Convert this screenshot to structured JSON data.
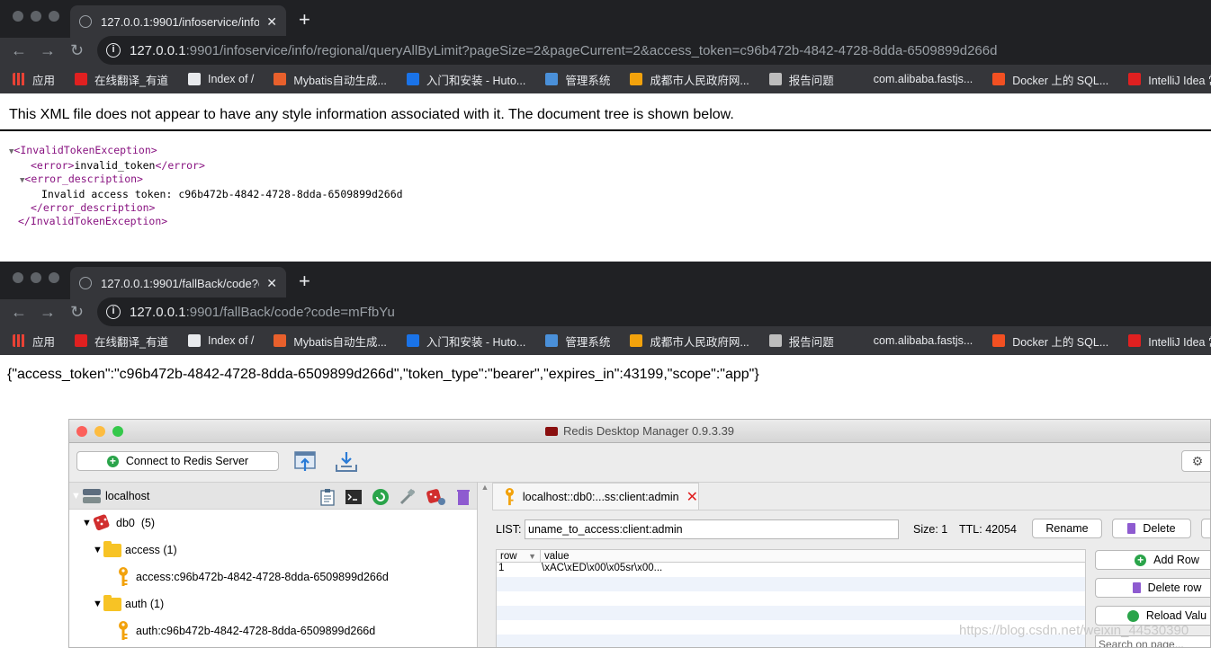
{
  "browser1": {
    "tab_title": "127.0.0.1:9901/infoservice/info",
    "url_host": "127.0.0.1",
    "url_rest": ":9901/infoservice/info/regional/queryAllByLimit?pageSize=2&pageCurrent=2&access_token=c96b472b-4842-4728-8dda-6509899d266d"
  },
  "browser2": {
    "tab_title": "127.0.0.1:9901/fallBack/code?c",
    "url_host": "127.0.0.1",
    "url_rest": ":9901/fallBack/code?code=mFfbYu"
  },
  "bookmarks": [
    {
      "label": "应用",
      "color": "#e94235"
    },
    {
      "label": "在线翻译_有道",
      "color": "#e02020"
    },
    {
      "label": "Index of /",
      "color": "#e8eaed"
    },
    {
      "label": "Mybatis自动生成...",
      "color": "#e8602c"
    },
    {
      "label": "入门和安装 - Huto...",
      "color": "#1a73e8"
    },
    {
      "label": "管理系统",
      "color": "#4a90d9"
    },
    {
      "label": "成都市人民政府网...",
      "color": "#f2a20c"
    },
    {
      "label": "报告问题",
      "color": "#bdbdbd"
    },
    {
      "label": "com.alibaba.fastjs...",
      "color": "#35363a"
    },
    {
      "label": "Docker 上的 SQL...",
      "color": "#f25022"
    },
    {
      "label": "IntelliJ Idea 常用",
      "color": "#e02020"
    }
  ],
  "xml": {
    "notice": "This XML file does not appear to have any style information associated with it. The document tree is shown below.",
    "root_open": "<InvalidTokenException>",
    "error_open": "<error>",
    "error_value": "invalid_token",
    "error_close": "</error>",
    "desc_open": "<error_description>",
    "desc_value": "Invalid access token: c96b472b-4842-4728-8dda-6509899d266d",
    "desc_close": "</error_description>",
    "root_close": "</InvalidTokenException>"
  },
  "json_response": "{\"access_token\":\"c96b472b-4842-4728-8dda-6509899d266d\",\"token_type\":\"bearer\",\"expires_in\":43199,\"scope\":\"app\"}",
  "rdm": {
    "window_title": "Redis Desktop Manager 0.9.3.39",
    "connect_label": "Connect to Redis Server",
    "server": "localhost",
    "db_name": "db0",
    "db_count": "(5)",
    "folders": [
      {
        "name": "access",
        "count": "(1)",
        "key": "access:c96b472b-4842-4728-8dda-6509899d266d"
      },
      {
        "name": "auth",
        "count": "(1)",
        "key": "auth:c96b472b-4842-4728-8dda-6509899d266d"
      }
    ],
    "key_tab": "localhost::db0:...ss:client:admin",
    "type_label": "LIST:",
    "key_name": "uname_to_access:client:admin",
    "size_label": "Size: 1",
    "ttl_label": "TTL:",
    "ttl_value": "42054",
    "rename_label": "Rename",
    "delete_label": "Delete",
    "col_row": "row",
    "col_value": "value",
    "rows": [
      {
        "row": "1",
        "value": "\\xAC\\xED\\x00\\x05sr\\x00..."
      }
    ],
    "add_row_label": "Add Row",
    "delete_row_label": "Delete row",
    "reload_label": "Reload Valu",
    "search_placeholder": "Search on page..."
  },
  "watermark": "https://blog.csdn.net/weixin_44530390"
}
